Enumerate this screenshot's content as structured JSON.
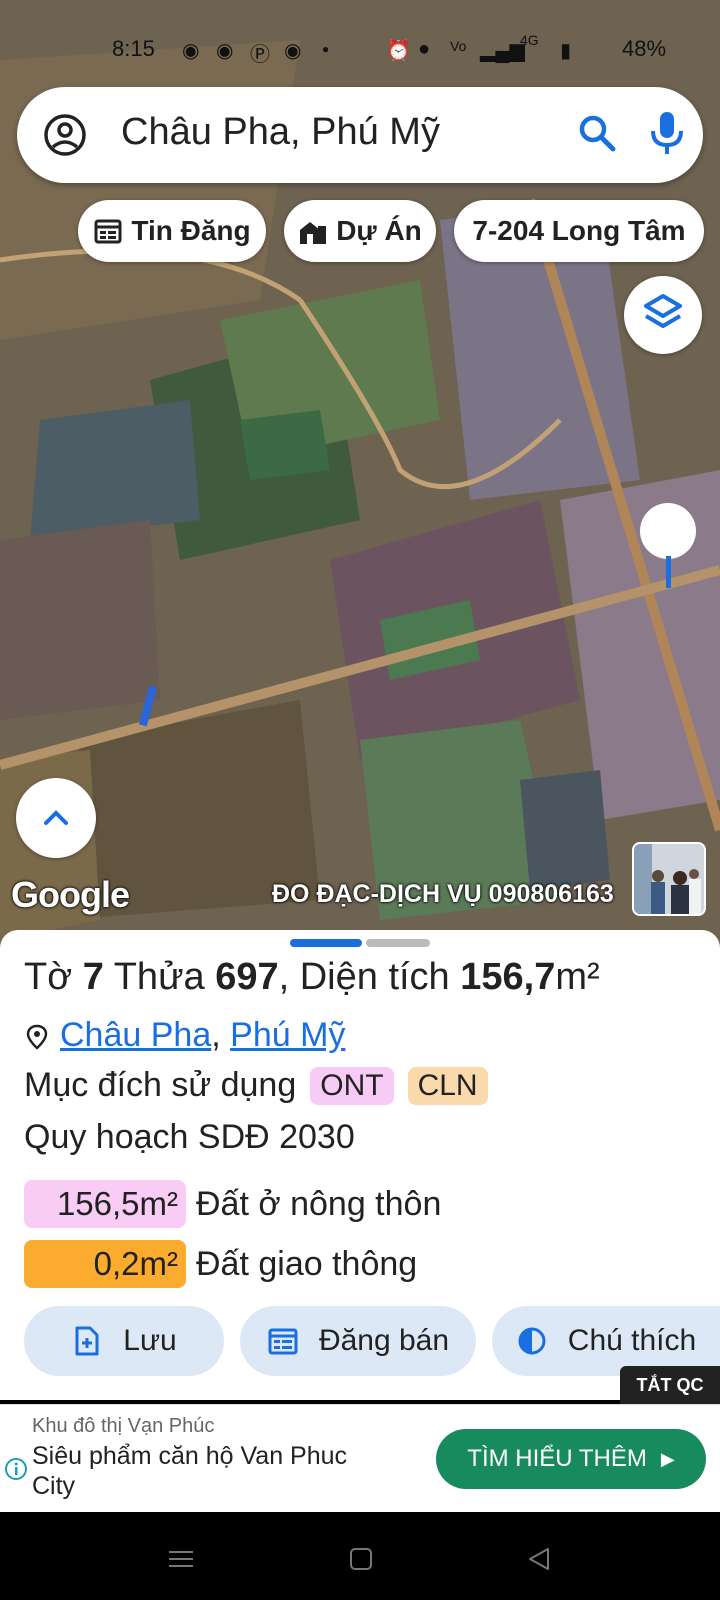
{
  "status_bar": {
    "time": "8:15",
    "network": "4G",
    "battery": "48%",
    "icons": [
      "chat-icon",
      "chat-icon",
      "facebook-icon",
      "chat-icon",
      "dot-icon",
      "alarm-icon",
      "location-icon",
      "volte-icon",
      "signal-icon",
      "battery-icon"
    ]
  },
  "search": {
    "query": "Châu Pha, Phú Mỹ"
  },
  "chips": [
    {
      "label": "Tin Đăng",
      "icon": "calendar-icon"
    },
    {
      "label": "Dự Án",
      "icon": "building-icon"
    },
    {
      "label": "7-204 Long Tâm",
      "icon": ""
    }
  ],
  "map": {
    "attribution": "Google",
    "watermark": "ĐO ĐẠC-DỊCH VỤ 090806163"
  },
  "parcel": {
    "sheet_label": "Tờ",
    "sheet_no": "7",
    "plot_label": "Thửa",
    "plot_no": "697",
    "area_label": "Diện tích",
    "area_value": "156,7",
    "area_unit": "m²",
    "location_parts": [
      "Châu Pha",
      "Phú Mỹ"
    ],
    "location_sep": ",",
    "purpose_label": "Mục đích sử dụng",
    "purpose_tags": [
      {
        "code": "ONT",
        "color": "#f7cbf5"
      },
      {
        "code": "CLN",
        "color": "#fad9ad"
      }
    ],
    "plan_label": "Quy hoạch SDĐ 2030",
    "plan_items": [
      {
        "area": "156,5m²",
        "label": "Đất ở nông thôn",
        "color": "#f9ccf6"
      },
      {
        "area": "0,2m²",
        "label": "Đất giao thông",
        "color": "#fbab2e"
      }
    ]
  },
  "actions": {
    "save": "Lưu",
    "post_sale": "Đăng bán",
    "legend": "Chú thích"
  },
  "ad": {
    "close_label": "TẮT QC",
    "brand": "Khu đô thị Vạn Phúc",
    "text": "Siêu phẩm căn hộ Van Phuc City",
    "cta": "TÌM HIỂU THÊM"
  },
  "colors": {
    "accent": "#1a6fe0",
    "button_bg": "#dde8f7",
    "cta_bg": "#178a5e"
  }
}
